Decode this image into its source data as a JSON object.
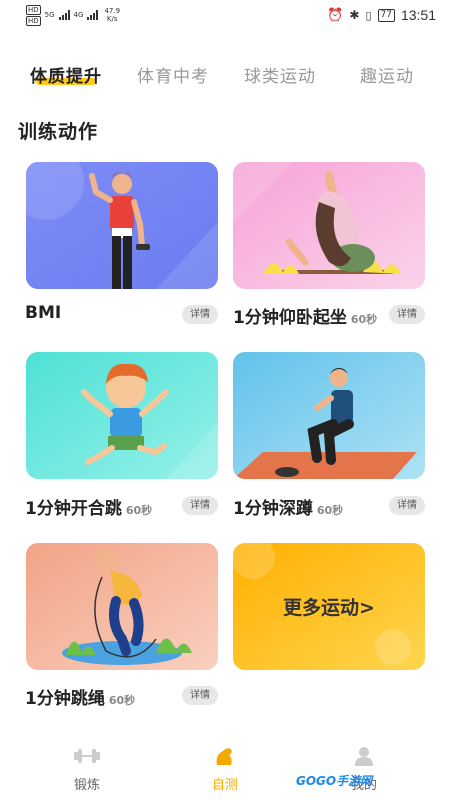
{
  "status_bar": {
    "hd1": "HD",
    "hd2": "HD",
    "sig1": "5G",
    "sig2": "4G",
    "net_speed_value": "47.9",
    "net_speed_unit": "K/s",
    "battery": "77",
    "time": "13:51"
  },
  "tabs": [
    {
      "label": "体质提升",
      "active": true
    },
    {
      "label": "体育中考",
      "active": false
    },
    {
      "label": "球类运动",
      "active": false
    },
    {
      "label": "趣运动",
      "active": false
    }
  ],
  "section_title": "训练动作",
  "cards": [
    {
      "label": "BMI",
      "duration": "",
      "detail": "详情",
      "illustration": "man-dumbbell",
      "gradient": [
        "#8f8ff5",
        "#6f8ef2"
      ]
    },
    {
      "label": "1分钟仰卧起坐",
      "duration": "60秒",
      "detail": "详情",
      "illustration": "woman-situp",
      "gradient": [
        "#f7a8d8",
        "#f9cfe8"
      ]
    },
    {
      "label": "1分钟开合跳",
      "duration": "60秒",
      "detail": "详情",
      "illustration": "boy-jumping-jack",
      "gradient": [
        "#56e2d8",
        "#8ef0e6"
      ]
    },
    {
      "label": "1分钟深蹲",
      "duration": "60秒",
      "detail": "详情",
      "illustration": "man-squat",
      "gradient": [
        "#6cc6ea",
        "#a8e0f4"
      ]
    },
    {
      "label": "1分钟跳绳",
      "duration": "60秒",
      "detail": "详情",
      "illustration": "man-jump-rope",
      "gradient": [
        "#f3a98d",
        "#f8cbb8"
      ]
    },
    {
      "label": "更多运动>",
      "duration": "",
      "detail": "",
      "illustration": "more",
      "gradient": [
        "#ffb300",
        "#ffd54f"
      ]
    }
  ],
  "bottom_nav": [
    {
      "label": "锻炼",
      "icon": "dumbbell-icon",
      "active": false
    },
    {
      "label": "自测",
      "icon": "flexed-arm-icon",
      "active": true
    },
    {
      "label": "我的",
      "icon": "user-icon",
      "active": false
    }
  ],
  "watermark": "GOGO手游网",
  "colors": {
    "accent": "#ffc400",
    "active_nav": "#f2a900"
  }
}
